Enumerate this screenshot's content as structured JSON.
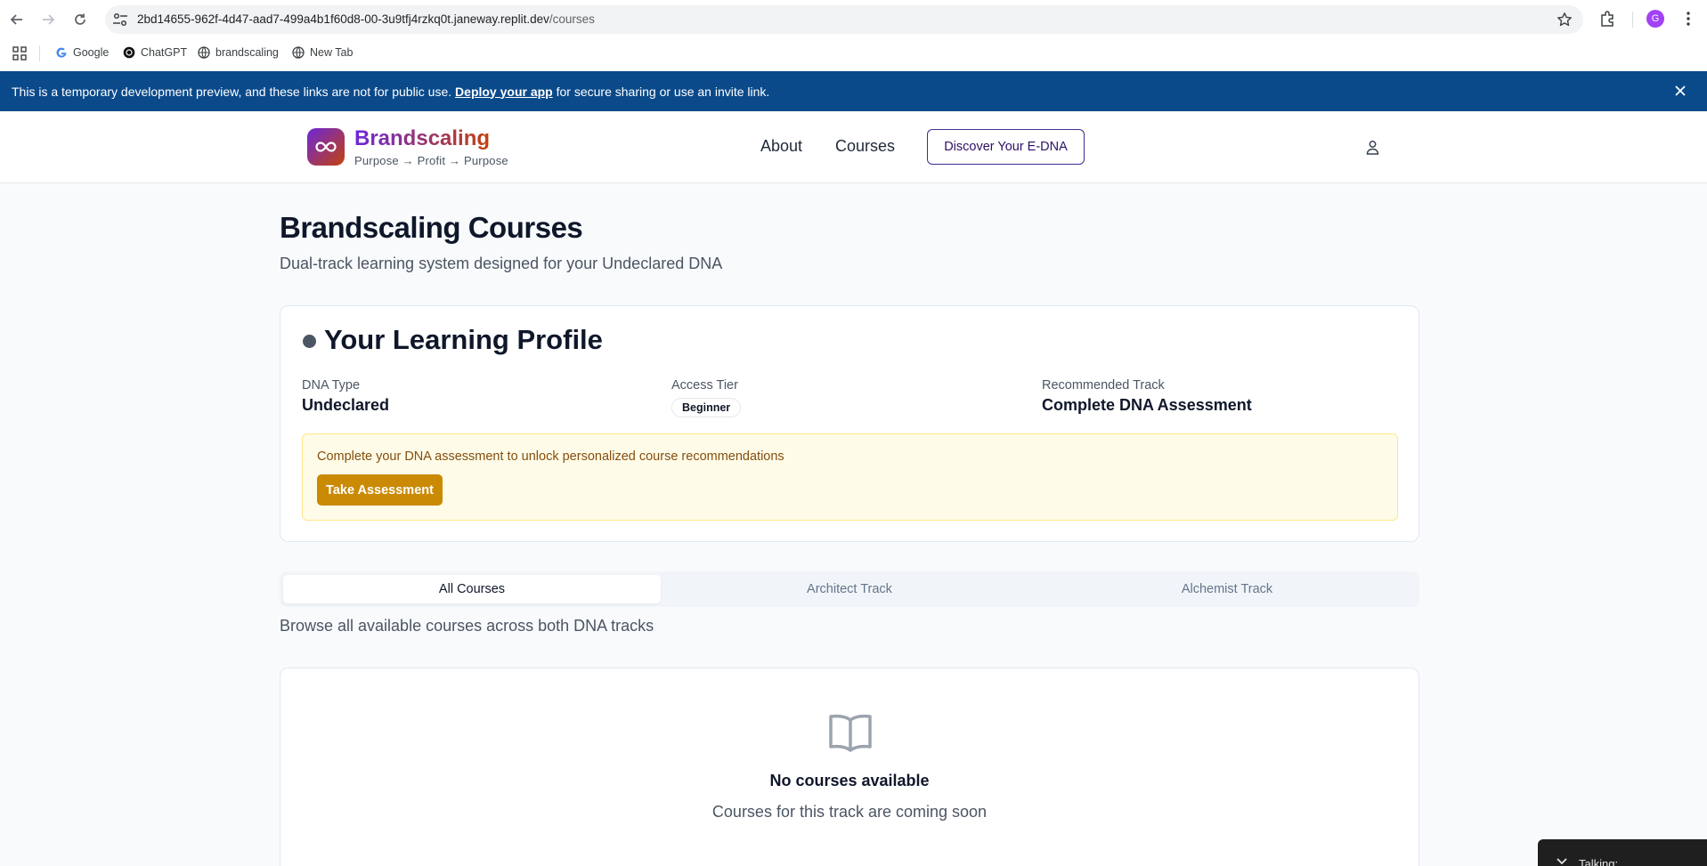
{
  "browser": {
    "url_main": "2bd14655-962f-4d47-aad7-499a4b1f60d8-00-3u9tfj4rzkq0t.janeway.replit.dev",
    "url_path": "/courses",
    "profile_initial": "G",
    "bookmarks": [
      {
        "label": "Google",
        "icon": "google-icon"
      },
      {
        "label": "ChatGPT",
        "icon": "chatgpt-icon"
      },
      {
        "label": "brandscaling",
        "icon": "globe-icon"
      },
      {
        "label": "New Tab",
        "icon": "globe-icon"
      }
    ]
  },
  "banner": {
    "text_before": "This is a temporary development preview, and these links are not for public use.",
    "link": "Deploy your app",
    "text_after": "for secure sharing or use an invite link."
  },
  "header": {
    "brand": "Brandscaling",
    "tagline": "Purpose → Profit → Purpose",
    "nav": [
      "About",
      "Courses"
    ],
    "cta": "Discover Your E-DNA"
  },
  "page": {
    "title": "Brandscaling Courses",
    "subtitle": "Dual-track learning system designed for your Undeclared DNA"
  },
  "profile": {
    "title": "Your Learning Profile",
    "dna_label": "DNA Type",
    "dna_value": "Undeclared",
    "tier_label": "Access Tier",
    "tier_value": "Beginner",
    "track_label": "Recommended Track",
    "track_value": "Complete DNA Assessment",
    "notice": "Complete your DNA assessment to unlock personalized course recommendations",
    "notice_button": "Take Assessment"
  },
  "tabs": {
    "items": [
      "All Courses",
      "Architect Track",
      "Alchemist Track"
    ],
    "active": "All Courses"
  },
  "browse_text": "Browse all available courses across both DNA tracks",
  "empty": {
    "title": "No courses available",
    "subtitle": "Courses for this track are coming soon"
  },
  "widget": {
    "label": "Talking:"
  },
  "colors": {
    "banner": "#0b4a8a",
    "brand_start": "#6d28d9",
    "brand_end": "#c2410c",
    "assess_button": "#ca8a04",
    "notice_bg": "#fefce8"
  }
}
